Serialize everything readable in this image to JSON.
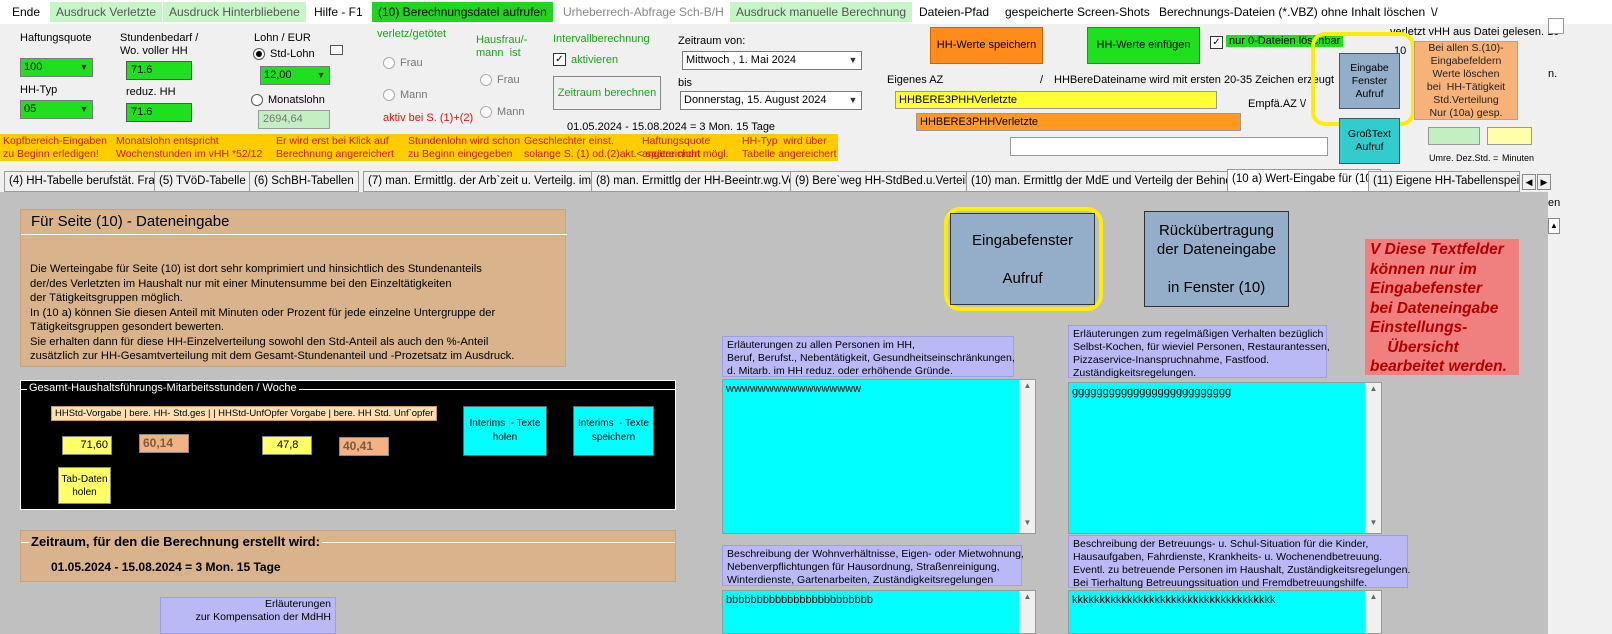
{
  "menu": [
    {
      "label": "Ende",
      "style": "plain"
    },
    {
      "label": "Ausdruck Verletzte",
      "style": "g"
    },
    {
      "label": "Ausdruck Hinterbliebene",
      "style": "g"
    },
    {
      "label": "Hilfe - F1",
      "style": "plain"
    },
    {
      "label": "(10)  Berechnungsdatei aufrufen",
      "style": "G"
    },
    {
      "label": "Urheberrech-Abfrage Sch-B/H",
      "style": "gray"
    },
    {
      "label": "Ausdruck manuelle Berechnung",
      "style": "g"
    },
    {
      "label": "Dateien-Pfad",
      "style": "plain"
    },
    {
      "label": "gespeicherte Screen-Shots",
      "style": "plain"
    },
    {
      "label": "Berechnungs-Dateien (*.VBZ) ohne Inhalt löschen",
      "style": "plain"
    },
    {
      "label": "\\/",
      "style": "plain"
    }
  ],
  "header": {
    "haftungsquote_label": "Haftungsquote",
    "haftungsquote_value": "100",
    "hh_typ_label": "HH-Typ",
    "hh_typ_value": "05",
    "stundenbedarf_label": "Stundenbedarf / Wo. voller HH",
    "stundenbedarf_value": "71.6",
    "reduz_label": "reduz. HH",
    "reduz_value": "71.6",
    "lohn_label": "Lohn / EUR",
    "std_lohn_label": "Std-Lohn",
    "std_lohn_value": "12,00",
    "monatslohn_label": "Monatslohn",
    "monatslohn_value": "2694,64",
    "verletzt_label": "verletz/getötet",
    "frau": "Frau",
    "mann": "Mann",
    "aktiv_text": "aktiv  bei S. (1)+(2)",
    "hausfrau_label": "Hausfrau/-\nmann  ist",
    "intervall_label": "Intervallberechnung",
    "aktivieren_label": "aktivieren",
    "zeitraum_btn": "Zeitraum berechnen",
    "zeitraum_von_label": "Zeitraum von:",
    "von_date": "Mittwoch  ,   1.     Mai       2024",
    "bis_label": "bis",
    "bis_date": "Donnerstag, 15.   August    2024",
    "period_text": "01.05.2024  -  15.08.2024  =   3 Mon.  15 Tage",
    "hh_speichern": "HH-Werte  speichern",
    "hh_einfuegen": "HH-Werte  einfügen",
    "nur0_label": "nur 0-Dateien löschbar",
    "top_right_text": "verletzt vHH aus Datei gelesen.  10",
    "num10": "10",
    "eigenes_az_label": "Eigenes AZ",
    "slash": "/",
    "hhbere_hint": "HHBereDateiname wird mit ersten 20-35 Zeichen  erzeugt",
    "empfae_label": "Empfä.AZ  \\/",
    "az_value1": "HHBERE3PHHVerletzte",
    "az_value2": "HHBERE3PHHVerletzte",
    "eingabe_fenster_btn": "Eingabe\nFenster\nAufruf",
    "grosstext_btn": "GroßText\nAufruf",
    "bei_allen_btn": "Bei allen S.(10)-\nEingabefeldern\nWerte löschen\nbei  HH-Tätigkeit\nStd.Verteilung\nNur (10a) gesp.",
    "umre_label": "Umre.  Dez.Std. =",
    "minuten_label": "Minuten",
    "side_n": "n.",
    "side_en": "en"
  },
  "infobar": [
    "Kopfbereich-Eingaben\nzu Beginn erledigen!",
    "Monatslohn entspricht\nWochenstunden im vHH *52/12",
    "Er wird erst bei Klick auf\nBerechnung angereichert",
    "Stundenlohn wird schon\nzu Beginn eingegeben",
    "Geschlechter einst.\nsolange S. (1) od.(2)akt.< später nicht mögl.",
    "Haftungsquote\nangereichert",
    "HH-Typ  wird über\nTabelle angereichert"
  ],
  "tabs": [
    "(4) HH-Tabelle berufstät. Frau",
    "(5) TVöD-Tabelle",
    "(6) SchBH-Tabellen",
    "(7) man. Ermittlg. der Arb`zeit u. Verteilg. im HH",
    "(8) man. Ermittlg der HH-Beeintr.wg.Verl.",
    "(9) Bere`weg HH-StdBed.u.Verteilg.",
    "(10) man. Ermittlg der MdE und Verteilg der Behinderg",
    "(10 a) Wert-Eingabe für (10)",
    "(11) Eigene HH-Tabellenspeiche"
  ],
  "main": {
    "section_title": "Für  Seite (10)  -   Dateneingabe",
    "description": [
      "Die Werteingabe für Seite (10) ist dort sehr komprimiert und hinsichtlich des Stundenanteils",
      "der/des Verletzten im Haushalt nur mit einer Minutensumme  bei den Einzeltätigkeiten",
      "der Tätigkeitsgruppen möglich.",
      "In (10 a) können Sie diesen Anteil mit Minuten oder Prozent für jede einzelne Untergruppe der",
      "Tätigkeitsgruppen gesondert bewerten.",
      "Sie erhalten dann für diese HH-Einzelverteilung sowohl den Std-Anteil als auch den %-Anteil",
      "zusätzlich zur HH-Gesamtverteilung mit dem Gesamt-Stundenanteil und -Prozetsatz im Ausdruck."
    ],
    "gesamt_title": "Gesamt-Haushaltsführungs-Mitarbeitsstunden / Woche",
    "gesamt_header": "HHStd-Vorgabe  | bere. HH- Std.ges |  |  HHStd-UnfOpfer Vorgabe  | bere. HH Std. Unf`opfer",
    "v1": "71,60",
    "v2": "60,14",
    "v3": "47,8",
    "v4": "40,41",
    "tab_daten_btn": "Tab-Daten\nholen",
    "interims_holen": "Interims  - Texte\nholen",
    "interims_speichern": "Interims  - Texte\nspeichern",
    "zeitraum_title": "Zeitraum, für den die Berechnung erstellt wird:",
    "zeitraum_value": "01.05.2024  -  15.08.2024  =   3 Mon.  15 Tage",
    "erlaeuterungen_small": "Erläuterungen\nzur Kompensation der MdHH",
    "big_eingabe_btn": "Eingabefenster\n\nAufruf",
    "rueck_btn": "Rückübertragung\nder Dateneingabe\n\nin Fenster (10)",
    "red_note": "V Diese Textfelder\nkönnen nur im\nEingabefenster\nbei Dateneingabe\nEinstellungs-\n    Übersicht\nbearbeitet werden.",
    "lav1": "Erläuterungen zu allen Personen im HH,\nBeruf, Berufst., Nebentätigkeit, Gesundheitseinschränkungen,\nd. Mitarb. im HH reduz. oder erhöhende Gründe.",
    "lav2": "Erläuterungen zum regelmäßigen Verhalten bezüglich\nSelbst-Kochen, für wieviel Personen, Restaurantessen,\nPizzaservice-Inanspruchnahme, Fastfood.\nZuständigkeitsregelungen.",
    "lav3": "Beschreibung der Wohnverhältnisse, Eigen- oder Mietwohnung,\nNebenverpflichtungen für Hausordnung, Straßenreinigung,\nWinterdienste, Gartenarbeiten, Zuständigkeitsregelungen",
    "lav4": "Beschreibung der Betreuungs- u. Schul-Situation für die Kinder,\nHausaufgaben, Fahrdienste, Krankheits- u. Wochenendbetreuung.\nEventl. zu betreuende Personen im Haushalt, Zuständigkeitsregelungen.\nBei Tierhaltung Betreuungssituation und Fremdbetreuungshilfe.",
    "text1": "wwwwwwwwwwwwwwwww",
    "text2": "gggggggggggggggggggggggggg",
    "text3": "bbbbbbbbbbbbbbbbbbbbbbbb",
    "text4": "kkkkkkkkkkkkkkkkkkkkkkkkkkkkkkkkkkkkk"
  },
  "colors": {
    "green_bright": "#1fe01f",
    "orange_btn": "#ff8c1a",
    "highlight_yellow": "#ffee00",
    "cyan": "#00ffff",
    "tan": "#d9b38c",
    "lavender": "#bbb9f5",
    "red_note": "#f08080"
  },
  "icons": {
    "dropdown": "chevron-down-icon",
    "checkbox": "checkbox-icon",
    "radio": "radio-icon",
    "scroll_up": "scroll-up-icon",
    "scroll_down": "scroll-down-icon"
  }
}
